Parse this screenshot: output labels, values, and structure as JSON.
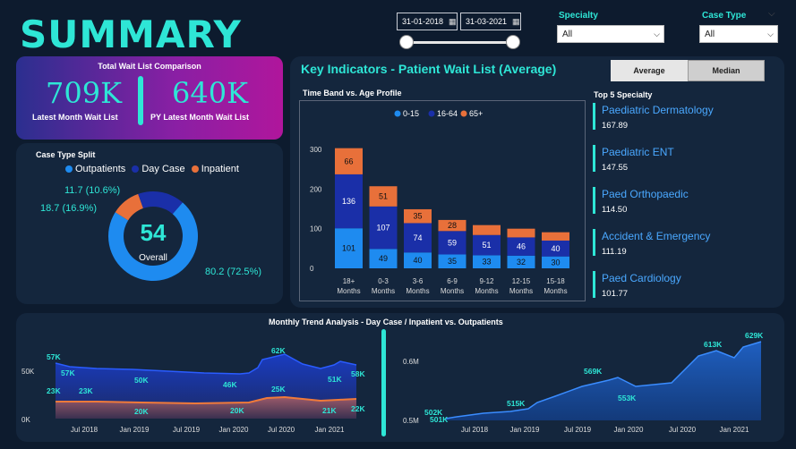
{
  "title": "SUMMARY",
  "date_range": {
    "start": "31-01-2018",
    "end": "31-03-2021"
  },
  "filters": {
    "specialty": {
      "label": "Specialty",
      "value": "All"
    },
    "case_type": {
      "label": "Case Type",
      "value": "All"
    }
  },
  "wait_list": {
    "title": "Total Wait List Comparison",
    "latest_value": "709K",
    "latest_label": "Latest Month Wait List",
    "py_value": "640K",
    "py_label": "PY Latest Month Wait List"
  },
  "case_split": {
    "title": "Case Type Split",
    "legend": [
      "Outpatients",
      "Day Case",
      "Inpatient"
    ],
    "center_value": "54",
    "center_label": "Overall",
    "labels": {
      "inpatient": "11.7 (10.6%)",
      "daycase": "18.7 (16.9%)",
      "outpatients": "80.2 (72.5%)"
    },
    "colors": {
      "outpatients": "#1e8bf0",
      "daycase": "#1a2fa8",
      "inpatient": "#e8703a"
    }
  },
  "key_indicators": {
    "title": "Key Indicators - Patient Wait List (Average)",
    "toggle": {
      "average": "Average",
      "median": "Median"
    }
  },
  "chart_data": {
    "type": "bar",
    "title": "Time Band vs. Age Profile",
    "categories": [
      "18+ Months",
      "0-3 Months",
      "3-6 Months",
      "6-9 Months",
      "9-12 Months",
      "12-15 Months",
      "15-18 Months"
    ],
    "category_lines": [
      [
        "18+",
        "Months"
      ],
      [
        "0-3",
        "Months"
      ],
      [
        "3-6",
        "Months"
      ],
      [
        "6-9",
        "Months"
      ],
      [
        "9-12",
        "Months"
      ],
      [
        "12-15",
        "Months"
      ],
      [
        "15-18",
        "Months"
      ]
    ],
    "series": [
      {
        "name": "0-15",
        "color": "#1e8bf0",
        "values": [
          101,
          49,
          40,
          35,
          33,
          32,
          30
        ]
      },
      {
        "name": "16-64",
        "color": "#1a2fa8",
        "values": [
          136,
          107,
          74,
          59,
          51,
          46,
          40
        ]
      },
      {
        "name": "65+",
        "color": "#e8703a",
        "values": [
          66,
          51,
          35,
          28,
          25,
          22,
          21
        ]
      }
    ],
    "labeled": [
      [
        true,
        true,
        true,
        true,
        true,
        true,
        true
      ],
      [
        true,
        true,
        true,
        true,
        true,
        true,
        true
      ],
      [
        true,
        true,
        true,
        true,
        false,
        false,
        false
      ]
    ],
    "yticks": [
      "0",
      "100",
      "200",
      "300"
    ],
    "ylim": [
      0,
      300
    ]
  },
  "top_specialty": {
    "title": "Top 5 Specialty",
    "items": [
      {
        "name": "Paediatric Dermatology",
        "value": "167.89"
      },
      {
        "name": "Paediatric ENT",
        "value": "147.55"
      },
      {
        "name": "Paed Orthopaedic",
        "value": "114.50"
      },
      {
        "name": "Accident & Emergency",
        "value": "111.19"
      },
      {
        "name": "Paed Cardiology",
        "value": "101.77"
      }
    ]
  },
  "trend": {
    "title": "Monthly Trend Analysis - Day Case / Inpatient vs. Outpatients",
    "left": {
      "yticks": [
        "50K",
        "0K"
      ],
      "xticks": [
        "Jul 2018",
        "Jan 2019",
        "Jul 2019",
        "Jan 2020",
        "Jul 2020",
        "Jan 2021"
      ],
      "labels_top": [
        "57K",
        "57K",
        "50K",
        "46K",
        "62K",
        "51K",
        "58K"
      ],
      "labels_bottom": [
        "23K",
        "23K",
        "20K",
        "20K",
        "25K",
        "21K",
        "22K"
      ]
    },
    "right": {
      "yticks": [
        "0.6M",
        "0.5M"
      ],
      "xticks": [
        "Jul 2018",
        "Jan 2019",
        "Jul 2019",
        "Jan 2020",
        "Jul 2020",
        "Jan 2021"
      ],
      "labels": [
        "502K",
        "501K",
        "515K",
        "569K",
        "553K",
        "613K",
        "629K"
      ]
    }
  }
}
